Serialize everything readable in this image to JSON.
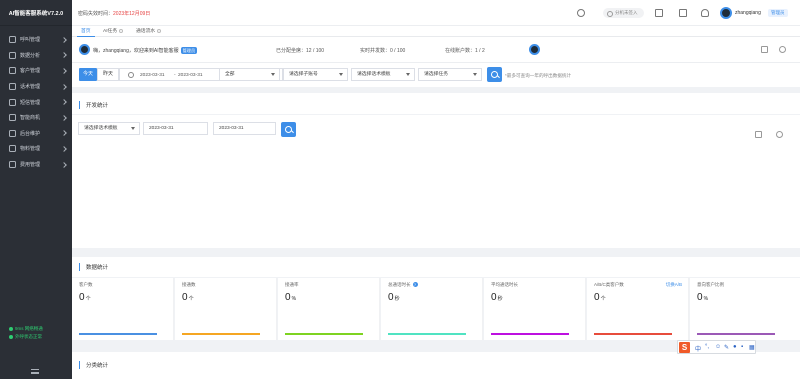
{
  "app": {
    "title": "AI智能客服系统V7.2.0"
  },
  "sidebar": {
    "items": [
      {
        "label": "呼叫管理"
      },
      {
        "label": "数据分析"
      },
      {
        "label": "客户管理"
      },
      {
        "label": "话术管理"
      },
      {
        "label": "短信管理"
      },
      {
        "label": "智能商机"
      },
      {
        "label": "后台维护"
      },
      {
        "label": "物料管理"
      },
      {
        "label": "费用管理"
      }
    ],
    "network": "9ms 网络畅通",
    "heartbeat": "外呼状态正常"
  },
  "topbar": {
    "pwd_label": "密码失效时间：",
    "pwd_date": "2023年12月09日",
    "extension": "分机未签入",
    "username": "zhangqiang",
    "role": "管理员"
  },
  "tabs": [
    {
      "label": "首页"
    },
    {
      "label": "AI任务"
    },
    {
      "label": "通话流水"
    }
  ],
  "welcome": {
    "greeting": "嗨，zhangqiang，欢迎来到AI智能客服",
    "role": "管理员",
    "seats": "已分配坐席：12 / 100",
    "concurrency": "实时并发数：0 / 100",
    "online": "在线账户数：1 / 2"
  },
  "filters": {
    "today": "今天",
    "yesterday": "昨天",
    "date_start": "2023-03-31",
    "date_sep": "-",
    "date_end": "2023-03-31",
    "scope": "全部",
    "sub_account": "请选择子账号",
    "template": "请选择话术模板",
    "task": "请选择任务",
    "hint": "*最多可查询一年的呼出数据统计"
  },
  "dev_stats": {
    "title": "开发统计",
    "template": "请选择话术模板",
    "date_start": "2023-03-31",
    "date_end": "2023-03-31"
  },
  "data_stats": {
    "title": "数据统计",
    "metrics": [
      {
        "label": "客户数",
        "value": "0",
        "unit": "个",
        "color": "#4a90e2"
      },
      {
        "label": "接通数",
        "value": "0",
        "unit": "个",
        "color": "#f5a623"
      },
      {
        "label": "接通率",
        "value": "0",
        "unit": "%",
        "color": "#7ed321"
      },
      {
        "label": "总通话时长",
        "value": "0",
        "unit": "秒",
        "color": "#50e3c2",
        "help": "?"
      },
      {
        "label": "平均通话时长",
        "value": "0",
        "unit": "秒",
        "color": "#bd10e0"
      },
      {
        "label": "A/B/C类客户数",
        "value": "0",
        "unit": "个",
        "color": "#e74c3c",
        "link": "切换A/B"
      },
      {
        "label": "意向客户比例",
        "value": "0",
        "unit": "%",
        "color": "#9b59b6"
      }
    ]
  },
  "category_stats": {
    "title": "分类统计"
  },
  "ime": {
    "logo": "S",
    "lang": "中"
  }
}
